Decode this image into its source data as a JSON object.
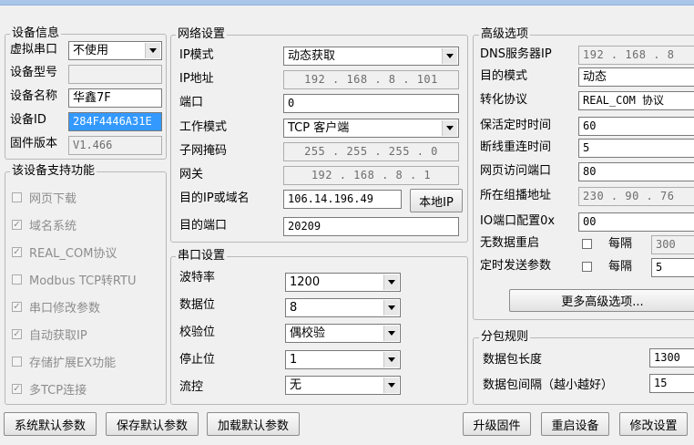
{
  "device_info": {
    "title": "设备信息",
    "virtual_port": {
      "label": "虚拟串口",
      "value": "不使用"
    },
    "model": {
      "label": "设备型号",
      "value": ""
    },
    "name": {
      "label": "设备名称",
      "value": "华鑫7F"
    },
    "id": {
      "label": "设备ID",
      "value": "284F4446A31E"
    },
    "firmware": {
      "label": "固件版本",
      "value": "V1.466"
    }
  },
  "features": {
    "title": "该设备支持功能",
    "items": [
      {
        "label": "网页下载",
        "checked": false
      },
      {
        "label": "域名系统",
        "checked": true
      },
      {
        "label": "REAL_COM协议",
        "checked": true
      },
      {
        "label": "Modbus TCP转RTU",
        "checked": false
      },
      {
        "label": "串口修改参数",
        "checked": true
      },
      {
        "label": "自动获取IP",
        "checked": true
      },
      {
        "label": "存储扩展EX功能",
        "checked": false
      },
      {
        "label": "多TCP连接",
        "checked": true
      }
    ]
  },
  "network": {
    "title": "网络设置",
    "ip_mode": {
      "label": "IP模式",
      "value": "动态获取"
    },
    "ip": {
      "label": "IP地址",
      "value": "192 . 168 .  8  . 101"
    },
    "port": {
      "label": "端口",
      "value": "0"
    },
    "work_mode": {
      "label": "工作模式",
      "value": "TCP 客户端"
    },
    "mask": {
      "label": "子网掩码",
      "value": "255 . 255 . 255 .  0"
    },
    "gateway": {
      "label": "网关",
      "value": "192 . 168 .  8  .  1"
    },
    "dest_ip": {
      "label": "目的IP或域名",
      "value": "106.14.196.49"
    },
    "local_ip_button": "本地IP",
    "dest_port": {
      "label": "目的端口",
      "value": "20209"
    }
  },
  "serial": {
    "title": "串口设置",
    "baud": {
      "label": "波特率",
      "value": "1200"
    },
    "data_bits": {
      "label": "数据位",
      "value": "8"
    },
    "parity": {
      "label": "校验位",
      "value": "偶校验"
    },
    "stop_bits": {
      "label": "停止位",
      "value": "1"
    },
    "flow": {
      "label": "流控",
      "value": "无"
    }
  },
  "advanced": {
    "title": "高级选项",
    "dns": {
      "label": "DNS服务器IP",
      "value": "192 . 168 .  8"
    },
    "dest_mode": {
      "label": "目的模式",
      "value": "动态"
    },
    "protocol": {
      "label": "转化协议",
      "value": "REAL_COM 协议"
    },
    "keepalive": {
      "label": "保活定时时间",
      "value": "60"
    },
    "reconnect": {
      "label": "断线重连时间",
      "value": "5"
    },
    "web_port": {
      "label": "网页访问端口",
      "value": "80"
    },
    "multicast": {
      "label": "所在组播地址",
      "value": "230 .  90  .  76"
    },
    "io_port": {
      "label": "IO端口配置0x",
      "value": "00"
    },
    "no_data_restart": {
      "label": "无数据重启",
      "every_label": "每隔",
      "value": "300"
    },
    "timed_send": {
      "label": "定时发送参数",
      "every_label": "每隔",
      "value": "5"
    },
    "more_button": "更多高级选项..."
  },
  "packet": {
    "title": "分包规则",
    "length": {
      "label": "数据包长度",
      "value": "1300"
    },
    "interval": {
      "label": "数据包间隔（越小越好）",
      "value": "15"
    }
  },
  "bottom_buttons": {
    "system_default": "系统默认参数",
    "save_default": "保存默认参数",
    "load_default": "加载默认参数",
    "upgrade": "升级固件",
    "restart": "重启设备",
    "modify": "修改设置"
  }
}
